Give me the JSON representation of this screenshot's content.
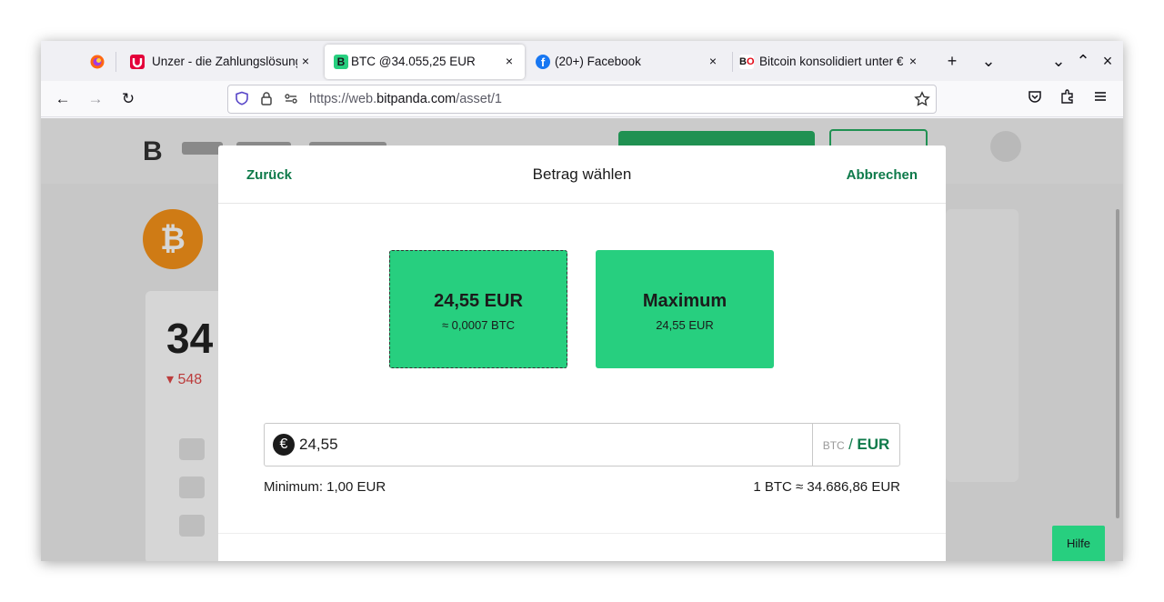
{
  "tabs": [
    {
      "title": "Unzer - die Zahlungslösung",
      "close": "×"
    },
    {
      "title": "BTC @34.055,25 EUR",
      "close": "×"
    },
    {
      "title": "(20+) Facebook",
      "close": "×"
    },
    {
      "title": "Bitcoin konsolidiert unter €",
      "close": "×"
    }
  ],
  "tabstrip": {
    "new_tab": "+",
    "list_tabs": "⌄",
    "minimize": "⌄",
    "maximize": "⌃",
    "close": "×"
  },
  "nav": {
    "back": "←",
    "forward": "→",
    "reload": "↻"
  },
  "url": {
    "prefix": "https://web.",
    "domain": "bitpanda.com",
    "path": "/asset/1"
  },
  "modal": {
    "back": "Zurück",
    "title": "Betrag wählen",
    "cancel": "Abbrechen",
    "options": [
      {
        "main": "24,55 EUR",
        "sub": "≈ 0,0007 BTC"
      },
      {
        "main": "Maximum",
        "sub": "24,55 EUR"
      }
    ],
    "input_value": "24,55",
    "currency_symbol": "€",
    "currency_off": "BTC",
    "currency_sep": "/",
    "currency_on": "EUR",
    "minimum": "Minimum: 1,00 EUR",
    "rate": "1 BTC ≈ 34.686,86 EUR"
  },
  "help": "Hilfe",
  "colors": {
    "accent": "#27cf7f",
    "link": "#0e7a4a"
  }
}
